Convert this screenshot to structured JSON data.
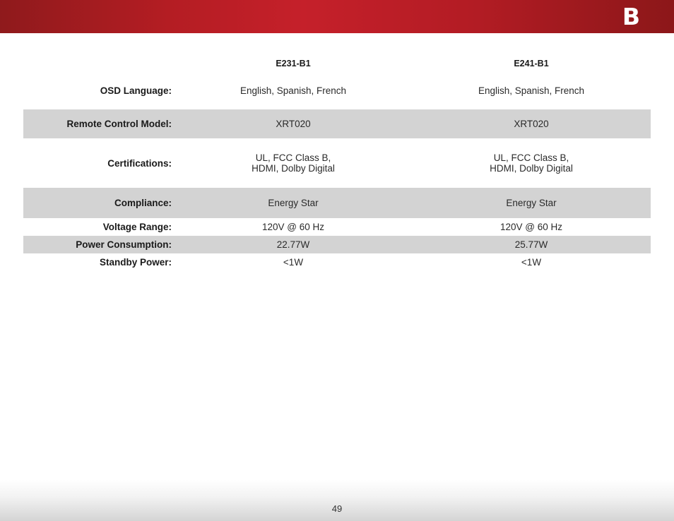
{
  "header": {
    "appendix_letter": "B"
  },
  "table": {
    "columns": [
      "E231-B1",
      "E241-B1"
    ],
    "rows": [
      {
        "label": "OSD Language:",
        "values": [
          "English, Spanish, French",
          "English, Spanish, French"
        ]
      },
      {
        "label": "Remote Control Model:",
        "values": [
          "XRT020",
          "XRT020"
        ]
      },
      {
        "label": "Certifications:",
        "values": [
          [
            "UL, FCC Class B,",
            "HDMI, Dolby Digital"
          ],
          [
            "UL, FCC Class B,",
            "HDMI, Dolby Digital"
          ]
        ]
      },
      {
        "label": "Compliance:",
        "values": [
          "Energy Star",
          "Energy Star"
        ]
      },
      {
        "label": "Voltage Range:",
        "values": [
          "120V @ 60 Hz",
          "120V @ 60 Hz"
        ]
      },
      {
        "label": "Power Consumption:",
        "values": [
          "22.77W",
          "25.77W"
        ]
      },
      {
        "label": "Standby Power:",
        "values": [
          "<1W",
          "<1W"
        ]
      }
    ]
  },
  "footer": {
    "page_number": "49"
  }
}
